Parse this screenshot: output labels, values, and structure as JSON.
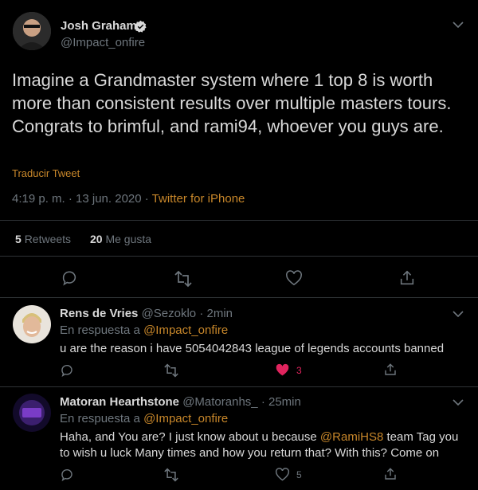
{
  "main_tweet": {
    "author_name": "Josh Graham",
    "author_handle": "@Impact_onfire",
    "text": "Imagine a Grandmaster system where 1 top 8 is worth more than consistent results over multiple masters tours. Congrats to brimful, and rami94, whoever you guys are.",
    "translate_label": "Traducir Tweet",
    "timestamp": "4:19 p. m. · 13 jun. 2020 · ",
    "source": "Twitter for iPhone",
    "retweets_count": "5",
    "retweets_label": "Retweets",
    "likes_count": "20",
    "likes_label": "Me gusta"
  },
  "replies": [
    {
      "author_name": "Rens de Vries",
      "author_handle": "@Sezoklo",
      "time": "· 2min",
      "reply_prefix": "En respuesta a ",
      "reply_to": "@Impact_onfire",
      "text": "u are the reason i have 5054042843 league of legends accounts banned",
      "likes": "3"
    },
    {
      "author_name": "Matoran Hearthstone",
      "author_handle": "@Matoranhs_",
      "time": "· 25min",
      "reply_prefix": "En respuesta a ",
      "reply_to": "@Impact_onfire",
      "text_before": "Haha, and You are? I just know about u because ",
      "mention": "@RamiHS8",
      "text_after": " team Tag you to wish u luck Many times and how you return that? With this? Come on",
      "likes": "5"
    }
  ],
  "colors": {
    "background": "#000000",
    "text": "#d9d9d9",
    "muted": "#6e767d",
    "link": "#1d9bf0",
    "like": "#e0245e"
  }
}
